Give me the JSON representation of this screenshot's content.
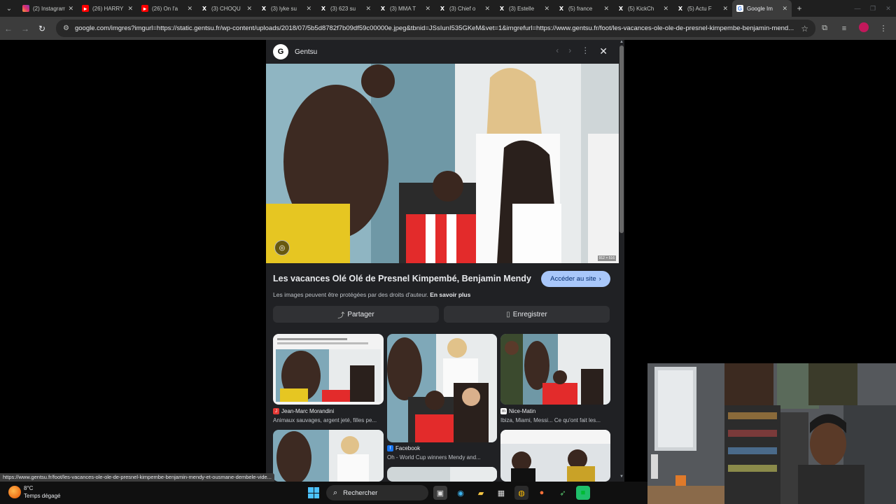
{
  "tabs": [
    {
      "label": "(2) Instagram",
      "icon": "instagram-icon"
    },
    {
      "label": "(26) HARRY",
      "icon": "youtube-icon"
    },
    {
      "label": "(26) On l'a",
      "icon": "youtube-icon"
    },
    {
      "label": "(3) CHOQU",
      "icon": "x-icon"
    },
    {
      "label": "(3) lyke su",
      "icon": "x-icon"
    },
    {
      "label": "(3) 623 su",
      "icon": "x-icon"
    },
    {
      "label": "(3) MMA T",
      "icon": "x-icon"
    },
    {
      "label": "(3) Chief o",
      "icon": "x-icon"
    },
    {
      "label": "(3) Estelle",
      "icon": "x-icon"
    },
    {
      "label": "(5) france",
      "icon": "x-icon"
    },
    {
      "label": "(5) KickCh",
      "icon": "x-icon"
    },
    {
      "label": "(5) Actu F",
      "icon": "x-icon"
    },
    {
      "label": "Google Im",
      "icon": "google-icon",
      "active": true
    }
  ],
  "address_bar": {
    "url": "google.com/imgres?imgurl=https://static.gentsu.fr/wp-content/uploads/2018/07/5b5d8782f7b09df59c00000e.jpeg&tbnid=JSsIunI535GKeM&vet=1&imgrefurl=https://www.gentsu.fr/foot/les-vacances-ole-ole-de-presnel-kimpembe-benjamin-mend..."
  },
  "panel": {
    "site_logo_letter": "G",
    "site_name": "Gentsu",
    "image_dims": "912 × 516",
    "title": "Les vacances Olé Olé de Presnel Kimpembé, Benjamin Mendy et ...",
    "visit_label": "Accéder au site",
    "copyright_text": "Les images peuvent être protégées par des droits d'auteur.",
    "learn_more": "En savoir plus",
    "share_label": "Partager",
    "save_label": "Enregistrer"
  },
  "related": [
    {
      "source": "Jean-Marc Morandini",
      "caption": "Animaux sauvages, argent jeté, filles pe...",
      "icon_color": "#e53935"
    },
    {
      "source": "Facebook",
      "caption": "Oh - World Cup winners Mendy and...",
      "icon_color": "#1877f2"
    },
    {
      "source": "Nice-Matin",
      "caption": "Ibiza, Miami, Messi... Ce qu'ont fait les...",
      "icon_color": "#ffffff"
    }
  ],
  "status_url": "https://www.gentsu.fr/foot/les-vacances-ole-ole-de-presnel-kimpembe-benjamin-mendy-et-ousmane-dembele-vide...",
  "taskbar": {
    "temperature": "8°C",
    "weather": "Temps dégagé",
    "search_label": "Rechercher"
  },
  "colors": {
    "panel_bg": "#202124",
    "visit_button": "#a8c7fa",
    "page_bg": "#000000"
  }
}
